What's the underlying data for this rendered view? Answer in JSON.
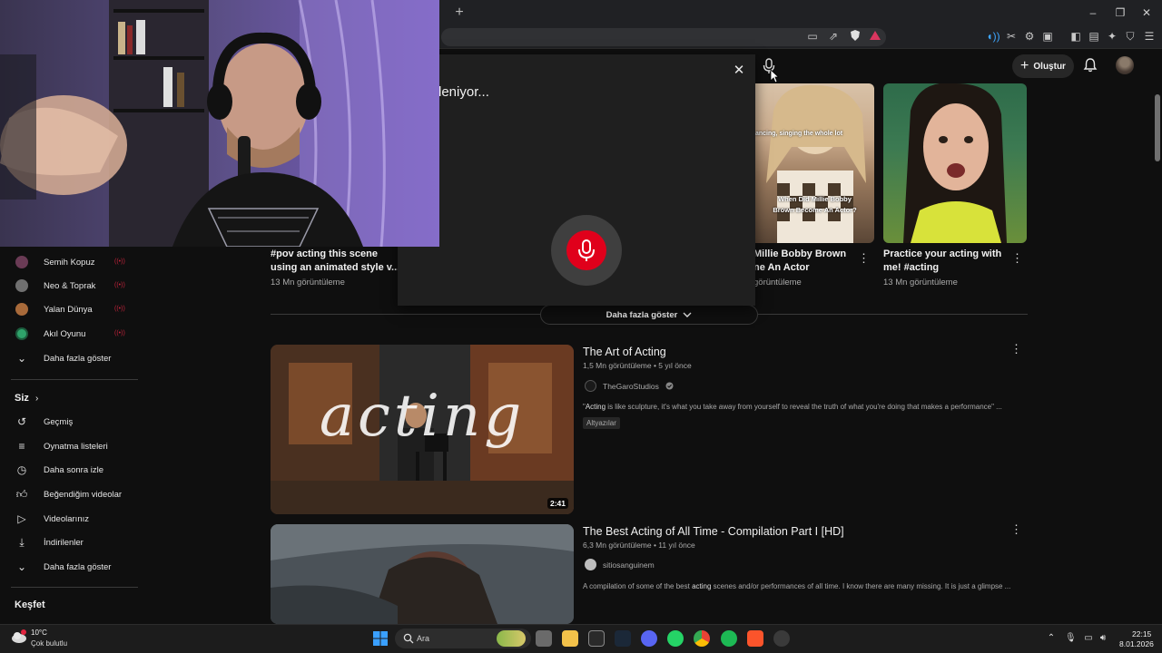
{
  "browser": {
    "new_tab_glyph": "+",
    "window_controls": [
      "–",
      "❐",
      "✕"
    ]
  },
  "header": {
    "create_label": "Oluştur"
  },
  "voice_search": {
    "status": "leniyor..."
  },
  "shorts": [
    {
      "title_line1": "#pov acting this scene",
      "title_line2": "using an animated style v...",
      "views": "13 Mn görüntüleme"
    },
    {
      "title_line1": "Millie Bobby Brown",
      "title_line2": "ne An Actor",
      "views": "görüntüleme",
      "overlay_top": "ancing, singing the whole lot",
      "overlay_q1": "When Did Millie Bobby",
      "overlay_q2": "Brown Become An Actor?"
    },
    {
      "title_line1": "Practice your acting with",
      "title_line2": "me! #acting",
      "views": "13 Mn görüntüleme"
    }
  ],
  "more_button": {
    "label": "Daha fazla göster"
  },
  "sidebar": {
    "channels": [
      {
        "label": "Semih Kopuz",
        "color": "#6a3b55"
      },
      {
        "label": "Neo & Toprak",
        "color": "#707070"
      },
      {
        "label": "Yalan Dünya",
        "color": "#a86a3a"
      },
      {
        "label": "Akıl Oyunu",
        "color": "#2fa36b"
      }
    ],
    "channels_more": "Daha fazla göster",
    "you_section": "Siz",
    "you_items": [
      {
        "label": "Geçmiş",
        "icon": "history-icon"
      },
      {
        "label": "Oynatma listeleri",
        "icon": "playlists-icon"
      },
      {
        "label": "Daha sonra izle",
        "icon": "watch-later-icon"
      },
      {
        "label": "Beğendiğim videolar",
        "icon": "liked-icon"
      },
      {
        "label": "Videolarınız",
        "icon": "your-videos-icon"
      },
      {
        "label": "İndirilenler",
        "icon": "downloads-icon"
      }
    ],
    "you_more": "Daha fazla göster",
    "explore_section": "Keşfet"
  },
  "videos": [
    {
      "title": "The Art of Acting",
      "meta": "1,5 Mn görüntüleme • 5 yıl önce",
      "channel": "TheGaroStudios",
      "desc_q": "\"",
      "desc_bold": "Acting",
      "desc_rest": " is like sculpture, it's what you take away from yourself to reveal the truth of what you're doing that makes a performance\" ...",
      "badge": "Altyazılar",
      "duration": "2:41",
      "thumb_word": "acting"
    },
    {
      "title": "The Best Acting of All Time - Compilation Part I [HD]",
      "meta": "6,3 Mn görüntüleme • 11 yıl önce",
      "channel": "sitiosanguinem",
      "desc_pre": "A compilation of some of the best ",
      "desc_bold": "acting",
      "desc_rest": " scenes and/or performances of all time. I know there are many missing. It is just a glimpse ..."
    }
  ],
  "taskbar": {
    "temperature": "10°C",
    "weather": "Çok bulutlu",
    "search_label": "Ara",
    "time": "22:15",
    "date": "8.01.2026"
  }
}
